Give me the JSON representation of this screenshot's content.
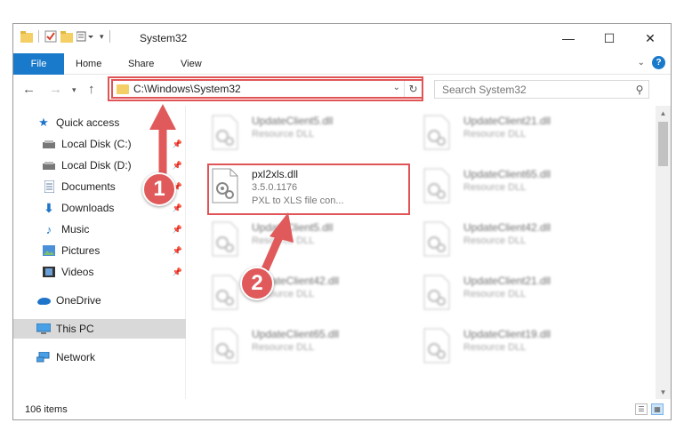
{
  "window": {
    "title": "System32",
    "minimize_glyph": "—",
    "maximize_glyph": "☐",
    "close_glyph": "✕"
  },
  "ribbon": {
    "tabs": [
      "File",
      "Home",
      "Share",
      "View"
    ],
    "help_label": "?"
  },
  "address": {
    "path": "C:\\Windows\\System32",
    "search_placeholder": "Search System32"
  },
  "sidebar": {
    "items": [
      {
        "label": "Quick access",
        "icon": "star-icon"
      },
      {
        "label": "Local Disk (C:)",
        "icon": "drive-icon",
        "pinned": true
      },
      {
        "label": "Local Disk (D:)",
        "icon": "drive-icon",
        "pinned": true
      },
      {
        "label": "Documents",
        "icon": "document-icon",
        "pinned": true
      },
      {
        "label": "Downloads",
        "icon": "download-icon",
        "pinned": true
      },
      {
        "label": "Music",
        "icon": "music-icon",
        "pinned": true
      },
      {
        "label": "Pictures",
        "icon": "picture-icon",
        "pinned": true
      },
      {
        "label": "Videos",
        "icon": "video-icon",
        "pinned": true
      },
      {
        "label": "OneDrive",
        "icon": "cloud-icon"
      },
      {
        "label": "This PC",
        "icon": "computer-icon",
        "selected": true
      },
      {
        "label": "Network",
        "icon": "network-icon"
      }
    ]
  },
  "files": [
    {
      "name": "UpdateClient5.dll",
      "desc": "Resource DLL"
    },
    {
      "name": "UpdateClient21.dll",
      "desc": "Resource DLL"
    },
    {
      "name": "pxl2xls.dll",
      "version": "3.5.0.1176",
      "desc": "PXL to XLS file con..."
    },
    {
      "name": "UpdateClient65.dll",
      "desc": "Resource DLL"
    },
    {
      "name": "UpdateClient5.dll",
      "desc": "Resource DLL"
    },
    {
      "name": "UpdateClient42.dll",
      "desc": "Resource DLL"
    },
    {
      "name": "UpdateClient42.dll",
      "desc": "Resource DLL"
    },
    {
      "name": "UpdateClient21.dll",
      "desc": "Resource DLL"
    },
    {
      "name": "UpdateClient65.dll",
      "desc": "Resource DLL"
    },
    {
      "name": "UpdateClient19.dll",
      "desc": "Resource DLL"
    }
  ],
  "status": {
    "item_count": "106 items"
  },
  "annotations": {
    "step1": "1",
    "step2": "2"
  },
  "colors": {
    "accent": "#1979ca",
    "highlight": "#e15456",
    "badge": "#e05a5b"
  }
}
